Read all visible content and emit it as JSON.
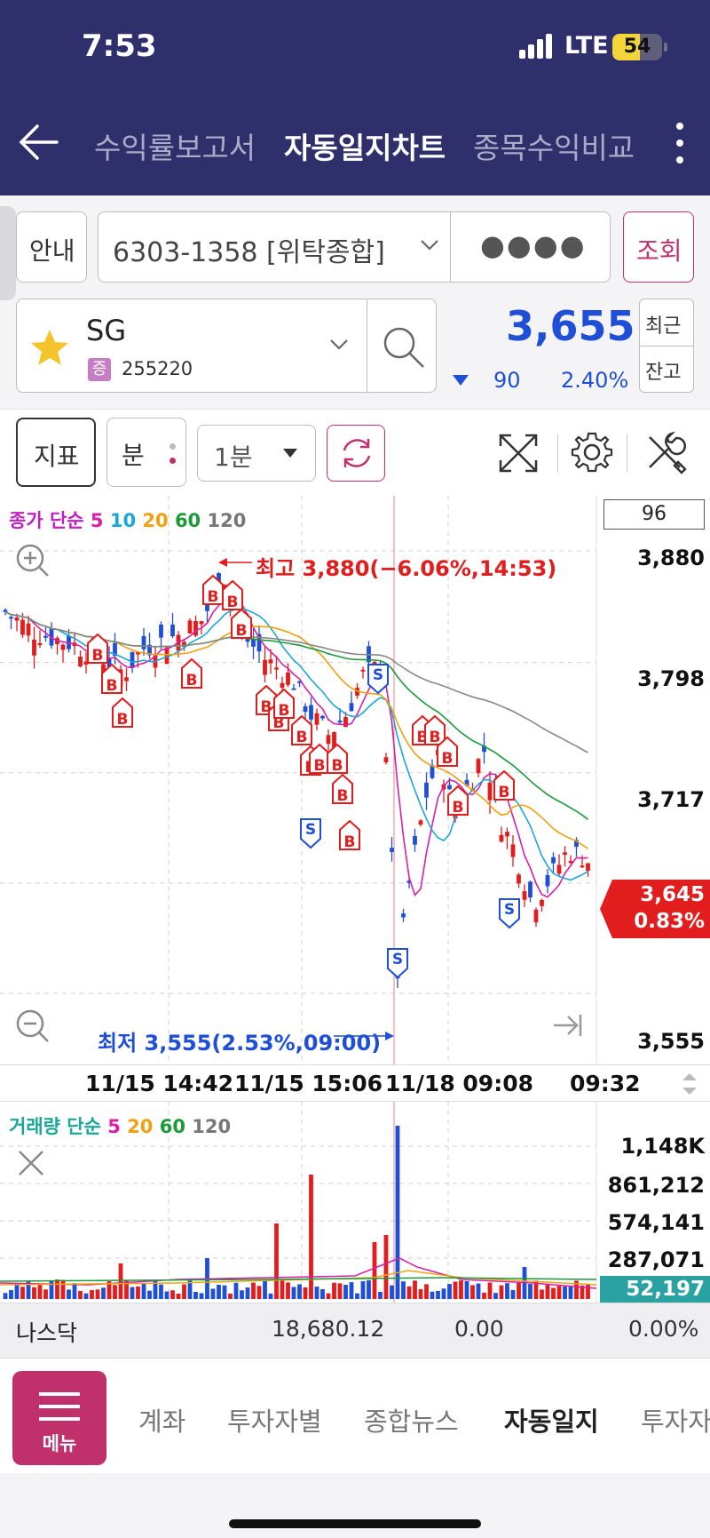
{
  "status": {
    "time": "7:53",
    "network": "LTE",
    "battery": "54"
  },
  "nav": {
    "tabs": [
      "수익률보고서",
      "자동일지차트",
      "종목수익비교"
    ],
    "active_tab": "자동일지차트"
  },
  "account": {
    "guide_label": "안내",
    "number": "6303-1358 [위탁종합]",
    "password_mask": "●●●●",
    "query_label": "조회"
  },
  "stock": {
    "name": "SG",
    "market_badge": "증",
    "code": "255220",
    "price": "3,655",
    "change": "90",
    "change_pct": "2.40%",
    "recent_label": "최근",
    "balance_label": "잔고"
  },
  "toolbar": {
    "indicator_label": "지표",
    "minute_label": "분",
    "interval": "1분"
  },
  "price_chart": {
    "legend": {
      "prefix": "종가 단순",
      "periods": [
        "5",
        "10",
        "20",
        "60",
        "120"
      ]
    },
    "count_box": "96",
    "high_label": "최고 3,880(−6.06%,14:53)",
    "low_label": "최저 3,555(2.53%,09:00)",
    "y_ticks": [
      "3,880",
      "3,798",
      "3,717",
      "3,555"
    ],
    "current_price": "3,645",
    "current_pct": "0.83%",
    "x_ticks": [
      "11/15 14:42",
      "11/15 15:06",
      "11/18 09:08",
      "09:32"
    ]
  },
  "volume_chart": {
    "legend": {
      "prefix": "거래량 단순",
      "periods": [
        "5",
        "20",
        "60",
        "120"
      ]
    },
    "y_ticks": [
      "1,148K",
      "861,212",
      "574,141",
      "287,071"
    ],
    "current": "52,197"
  },
  "index_bar": {
    "name": "나스닥",
    "value": "18,680.12",
    "change": "0.00",
    "change_pct": "0.00%"
  },
  "bottom_nav": {
    "menu_label": "메뉴",
    "items": [
      "계좌",
      "투자자별",
      "종합뉴스",
      "자동일지",
      "투자자"
    ]
  },
  "colors": {
    "header": "#2e2f6b",
    "up": "#e21d1d",
    "down": "#1f4fd6",
    "accent": "#c0306a"
  }
}
